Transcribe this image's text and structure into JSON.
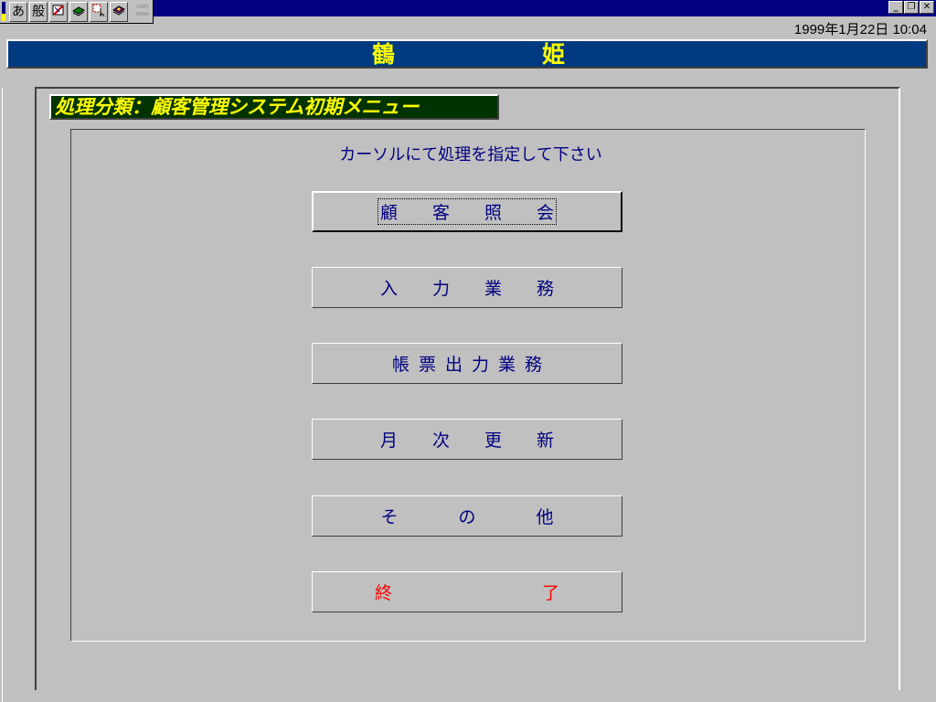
{
  "ime_toolbar": {
    "mode_label": "あ",
    "conversion_label": "般",
    "caps_label": "CAPS",
    "kana_label": "KANA"
  },
  "window_controls": {
    "minimize": "_",
    "restore": "❐",
    "close": "✕"
  },
  "datetime": "1999年1月22日  10:04",
  "header": {
    "char1": "鶴",
    "char2": "姫"
  },
  "category_label": "処理分類：顧客管理システム初期メニュー",
  "instruction": "カーソルにて処理を指定して下さい",
  "menu": {
    "customer_inquiry": [
      "顧",
      "客",
      "照",
      "会"
    ],
    "input_work": [
      "入",
      "力",
      "業",
      "務"
    ],
    "report_output": [
      "帳",
      "票",
      "出",
      "力",
      "業",
      "務"
    ],
    "monthly_update": [
      "月",
      "次",
      "更",
      "新"
    ],
    "others": [
      "そ",
      "の",
      "他"
    ],
    "exit": [
      "終",
      "了"
    ]
  },
  "colors": {
    "background": "#c0c0c0",
    "header_band": "#003a80",
    "header_text": "#ffff00",
    "category_bg": "#003300",
    "menu_text": "#000080",
    "exit_text": "#ff0000"
  }
}
